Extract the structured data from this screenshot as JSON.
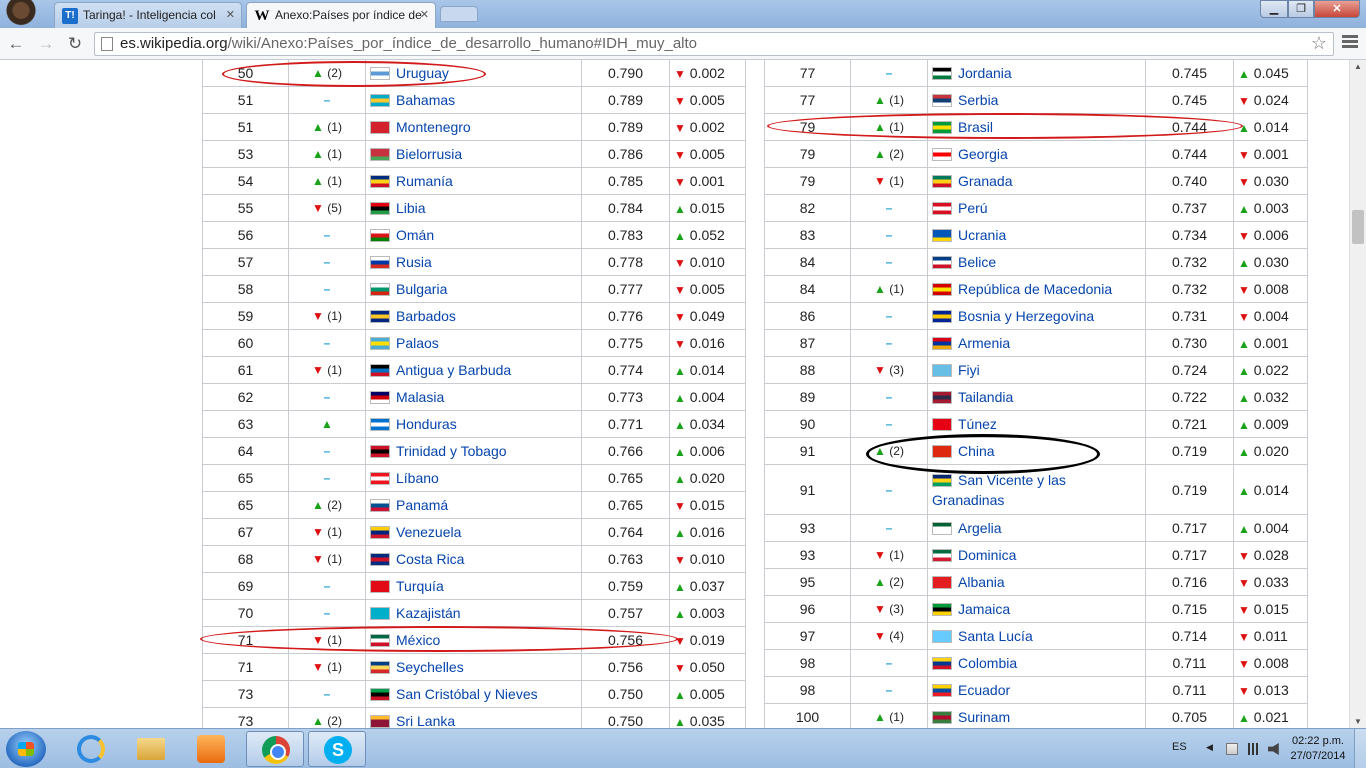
{
  "browser": {
    "tabs": [
      {
        "title": "Taringa! - Inteligencia col",
        "icon": "taringa-icon",
        "icon_text": "T!"
      },
      {
        "title": "Anexo:Países por índice de",
        "icon": "wikipedia-icon",
        "icon_text": "W"
      }
    ],
    "url_host": "es.wikipedia.org",
    "url_path": "/wiki/Anexo:Países_por_índice_de_desarrollo_humano#IDH_muy_alto"
  },
  "table_left": [
    {
      "rank": "50",
      "change": "up",
      "change_n": "(2)",
      "flag": [
        "#fff",
        "#5b9bd5",
        "#fff"
      ],
      "country": "Uruguay",
      "value": "0.790",
      "delta_dir": "down",
      "delta": "0.002"
    },
    {
      "rank": "51",
      "change": "none",
      "change_n": "",
      "flag": [
        "#00abc9",
        "#ffc72c",
        "#00abc9"
      ],
      "country": "Bahamas",
      "value": "0.789",
      "delta_dir": "down",
      "delta": "0.005"
    },
    {
      "rank": "51",
      "change": "up",
      "change_n": "(1)",
      "flag": [
        "#d3212d",
        "#d3212d",
        "#d3212d"
      ],
      "country": "Montenegro",
      "value": "0.789",
      "delta_dir": "down",
      "delta": "0.002"
    },
    {
      "rank": "53",
      "change": "up",
      "change_n": "(1)",
      "flag": [
        "#c8313e",
        "#c8313e",
        "#4aa657"
      ],
      "country": "Bielorrusia",
      "value": "0.786",
      "delta_dir": "down",
      "delta": "0.005"
    },
    {
      "rank": "54",
      "change": "up",
      "change_n": "(1)",
      "flag": [
        "#002b7f",
        "#fcd116",
        "#ce1126"
      ],
      "country": "Rumanía",
      "value": "0.785",
      "delta_dir": "down",
      "delta": "0.001"
    },
    {
      "rank": "55",
      "change": "down",
      "change_n": "(5)",
      "flag": [
        "#e70013",
        "#000",
        "#239e46"
      ],
      "country": "Libia",
      "value": "0.784",
      "delta_dir": "up",
      "delta": "0.015"
    },
    {
      "rank": "56",
      "change": "none",
      "change_n": "",
      "flag": [
        "#fff",
        "#db161b",
        "#008000"
      ],
      "country": "Omán",
      "value": "0.783",
      "delta_dir": "up",
      "delta": "0.052"
    },
    {
      "rank": "57",
      "change": "none",
      "change_n": "",
      "flag": [
        "#fff",
        "#0039a6",
        "#d52b1e"
      ],
      "country": "Rusia",
      "value": "0.778",
      "delta_dir": "down",
      "delta": "0.010"
    },
    {
      "rank": "58",
      "change": "none",
      "change_n": "",
      "flag": [
        "#fff",
        "#00966e",
        "#d62612"
      ],
      "country": "Bulgaria",
      "value": "0.777",
      "delta_dir": "down",
      "delta": "0.005"
    },
    {
      "rank": "59",
      "change": "down",
      "change_n": "(1)",
      "flag": [
        "#00267f",
        "#ffc726",
        "#00267f"
      ],
      "country": "Barbados",
      "value": "0.776",
      "delta_dir": "down",
      "delta": "0.049"
    },
    {
      "rank": "60",
      "change": "none",
      "change_n": "",
      "flag": [
        "#4aadd6",
        "#ffde00",
        "#4aadd6"
      ],
      "country": "Palaos",
      "value": "0.775",
      "delta_dir": "down",
      "delta": "0.016"
    },
    {
      "rank": "61",
      "change": "down",
      "change_n": "(1)",
      "flag": [
        "#000",
        "#0072c6",
        "#ce1126"
      ],
      "country": "Antigua y Barbuda",
      "value": "0.774",
      "delta_dir": "up",
      "delta": "0.014"
    },
    {
      "rank": "62",
      "change": "none",
      "change_n": "",
      "flag": [
        "#010066",
        "#cc0001",
        "#fff"
      ],
      "country": "Malasia",
      "value": "0.773",
      "delta_dir": "up",
      "delta": "0.004"
    },
    {
      "rank": "63",
      "change": "up",
      "change_n": "",
      "flag": [
        "#0073cf",
        "#fff",
        "#0073cf"
      ],
      "country": "Honduras",
      "value": "0.771",
      "delta_dir": "up",
      "delta": "0.034"
    },
    {
      "rank": "64",
      "change": "none",
      "change_n": "",
      "flag": [
        "#ce1126",
        "#000",
        "#ce1126"
      ],
      "country": "Trinidad y Tobago",
      "value": "0.766",
      "delta_dir": "up",
      "delta": "0.006"
    },
    {
      "rank": "65",
      "change": "none",
      "change_n": "",
      "flag": [
        "#ee161f",
        "#fff",
        "#ee161f"
      ],
      "country": "Líbano",
      "value": "0.765",
      "delta_dir": "up",
      "delta": "0.020"
    },
    {
      "rank": "65",
      "change": "up",
      "change_n": "(2)",
      "flag": [
        "#fff",
        "#005293",
        "#d21034"
      ],
      "country": "Panamá",
      "value": "0.765",
      "delta_dir": "down",
      "delta": "0.015"
    },
    {
      "rank": "67",
      "change": "down",
      "change_n": "(1)",
      "flag": [
        "#ffcc00",
        "#00247d",
        "#cf142b"
      ],
      "country": "Venezuela",
      "value": "0.764",
      "delta_dir": "up",
      "delta": "0.016"
    },
    {
      "rank": "68",
      "change": "down",
      "change_n": "(1)",
      "flag": [
        "#002b7f",
        "#ce1126",
        "#002b7f"
      ],
      "country": "Costa Rica",
      "value": "0.763",
      "delta_dir": "down",
      "delta": "0.010"
    },
    {
      "rank": "69",
      "change": "none",
      "change_n": "",
      "flag": [
        "#e30a17",
        "#e30a17",
        "#e30a17"
      ],
      "country": "Turquía",
      "value": "0.759",
      "delta_dir": "up",
      "delta": "0.037"
    },
    {
      "rank": "70",
      "change": "none",
      "change_n": "",
      "flag": [
        "#00afca",
        "#00afca",
        "#00afca"
      ],
      "country": "Kazajistán",
      "value": "0.757",
      "delta_dir": "up",
      "delta": "0.003"
    },
    {
      "rank": "71",
      "change": "down",
      "change_n": "(1)",
      "flag": [
        "#006847",
        "#fff",
        "#ce1126"
      ],
      "country": "México",
      "value": "0.756",
      "delta_dir": "down",
      "delta": "0.019"
    },
    {
      "rank": "71",
      "change": "down",
      "change_n": "(1)",
      "flag": [
        "#003f87",
        "#fcd856",
        "#d62828"
      ],
      "country": "Seychelles",
      "value": "0.756",
      "delta_dir": "down",
      "delta": "0.050"
    },
    {
      "rank": "73",
      "change": "none",
      "change_n": "",
      "flag": [
        "#009e49",
        "#000",
        "#ce1126"
      ],
      "country": "San Cristóbal y Nieves",
      "value": "0.750",
      "delta_dir": "up",
      "delta": "0.005"
    },
    {
      "rank": "73",
      "change": "up",
      "change_n": "(2)",
      "flag": [
        "#ffbe29",
        "#8d153a",
        "#8d153a"
      ],
      "country": "Sri Lanka",
      "value": "0.750",
      "delta_dir": "up",
      "delta": "0.035"
    }
  ],
  "table_right": [
    {
      "rank": "77",
      "change": "none",
      "change_n": "",
      "flag": [
        "#000",
        "#fff",
        "#007a3d"
      ],
      "country": "Jordania",
      "value": "0.745",
      "delta_dir": "up",
      "delta": "0.045"
    },
    {
      "rank": "77",
      "change": "up",
      "change_n": "(1)",
      "flag": [
        "#c6363c",
        "#0c4076",
        "#fff"
      ],
      "country": "Serbia",
      "value": "0.745",
      "delta_dir": "down",
      "delta": "0.024"
    },
    {
      "rank": "79",
      "change": "up",
      "change_n": "(1)",
      "flag": [
        "#009c3b",
        "#ffdf00",
        "#009c3b"
      ],
      "country": "Brasil",
      "value": "0.744",
      "delta_dir": "up",
      "delta": "0.014"
    },
    {
      "rank": "79",
      "change": "up",
      "change_n": "(2)",
      "flag": [
        "#fff",
        "#ff0000",
        "#fff"
      ],
      "country": "Georgia",
      "value": "0.744",
      "delta_dir": "down",
      "delta": "0.001"
    },
    {
      "rank": "79",
      "change": "down",
      "change_n": "(1)",
      "flag": [
        "#007a5e",
        "#fcd116",
        "#ce1126"
      ],
      "country": "Granada",
      "value": "0.740",
      "delta_dir": "down",
      "delta": "0.030"
    },
    {
      "rank": "82",
      "change": "none",
      "change_n": "",
      "flag": [
        "#d91023",
        "#fff",
        "#d91023"
      ],
      "country": "Perú",
      "value": "0.737",
      "delta_dir": "up",
      "delta": "0.003"
    },
    {
      "rank": "83",
      "change": "none",
      "change_n": "",
      "flag": [
        "#0057b7",
        "#0057b7",
        "#ffd700"
      ],
      "country": "Ucrania",
      "value": "0.734",
      "delta_dir": "down",
      "delta": "0.006"
    },
    {
      "rank": "84",
      "change": "none",
      "change_n": "",
      "flag": [
        "#003f87",
        "#fff",
        "#ce1126"
      ],
      "country": "Belice",
      "value": "0.732",
      "delta_dir": "up",
      "delta": "0.030"
    },
    {
      "rank": "84",
      "change": "up",
      "change_n": "(1)",
      "flag": [
        "#d20000",
        "#ffe600",
        "#d20000"
      ],
      "country": "República de Macedonia",
      "value": "0.732",
      "delta_dir": "down",
      "delta": "0.008"
    },
    {
      "rank": "86",
      "change": "none",
      "change_n": "",
      "flag": [
        "#002395",
        "#fecb00",
        "#002395"
      ],
      "country": "Bosnia y Herzegovina",
      "value": "0.731",
      "delta_dir": "down",
      "delta": "0.004"
    },
    {
      "rank": "87",
      "change": "none",
      "change_n": "",
      "flag": [
        "#d90012",
        "#0033a0",
        "#f2a800"
      ],
      "country": "Armenia",
      "value": "0.730",
      "delta_dir": "up",
      "delta": "0.001"
    },
    {
      "rank": "88",
      "change": "down",
      "change_n": "(3)",
      "flag": [
        "#68bfe5",
        "#68bfe5",
        "#68bfe5"
      ],
      "country": "Fiyi",
      "value": "0.724",
      "delta_dir": "up",
      "delta": "0.022"
    },
    {
      "rank": "89",
      "change": "none",
      "change_n": "",
      "flag": [
        "#a51931",
        "#2d2a4a",
        "#a51931"
      ],
      "country": "Tailandia",
      "value": "0.722",
      "delta_dir": "up",
      "delta": "0.032"
    },
    {
      "rank": "90",
      "change": "none",
      "change_n": "",
      "flag": [
        "#e70013",
        "#e70013",
        "#e70013"
      ],
      "country": "Túnez",
      "value": "0.721",
      "delta_dir": "up",
      "delta": "0.009"
    },
    {
      "rank": "91",
      "change": "up",
      "change_n": "(2)",
      "flag": [
        "#de2910",
        "#de2910",
        "#de2910"
      ],
      "country": "China",
      "value": "0.719",
      "delta_dir": "up",
      "delta": "0.020"
    },
    {
      "rank": "91",
      "change": "none",
      "change_n": "",
      "flag": [
        "#002675",
        "#fcd116",
        "#009e60"
      ],
      "country": "San Vicente y las Granadinas",
      "value": "0.719",
      "delta_dir": "up",
      "delta": "0.014",
      "tall": true
    },
    {
      "rank": "93",
      "change": "none",
      "change_n": "",
      "flag": [
        "#006233",
        "#fff",
        "#fff"
      ],
      "country": "Argelia",
      "value": "0.717",
      "delta_dir": "up",
      "delta": "0.004"
    },
    {
      "rank": "93",
      "change": "down",
      "change_n": "(1)",
      "flag": [
        "#006b3f",
        "#fff",
        "#d41c30"
      ],
      "country": "Dominica",
      "value": "0.717",
      "delta_dir": "down",
      "delta": "0.028"
    },
    {
      "rank": "95",
      "change": "up",
      "change_n": "(2)",
      "flag": [
        "#e41e20",
        "#e41e20",
        "#e41e20"
      ],
      "country": "Albania",
      "value": "0.716",
      "delta_dir": "down",
      "delta": "0.033"
    },
    {
      "rank": "96",
      "change": "down",
      "change_n": "(3)",
      "flag": [
        "#009b3a",
        "#000",
        "#fed100"
      ],
      "country": "Jamaica",
      "value": "0.715",
      "delta_dir": "down",
      "delta": "0.015"
    },
    {
      "rank": "97",
      "change": "down",
      "change_n": "(4)",
      "flag": [
        "#66ccff",
        "#66ccff",
        "#66ccff"
      ],
      "country": "Santa Lucía",
      "value": "0.714",
      "delta_dir": "down",
      "delta": "0.011"
    },
    {
      "rank": "98",
      "change": "none",
      "change_n": "",
      "flag": [
        "#fcd116",
        "#003893",
        "#ce1126"
      ],
      "country": "Colombia",
      "value": "0.711",
      "delta_dir": "down",
      "delta": "0.008"
    },
    {
      "rank": "98",
      "change": "none",
      "change_n": "",
      "flag": [
        "#ffd100",
        "#034ea2",
        "#ed1c24"
      ],
      "country": "Ecuador",
      "value": "0.711",
      "delta_dir": "down",
      "delta": "0.013"
    },
    {
      "rank": "100",
      "change": "up",
      "change_n": "(1)",
      "flag": [
        "#377e3f",
        "#b40a2d",
        "#377e3f"
      ],
      "country": "Surinam",
      "value": "0.705",
      "delta_dir": "up",
      "delta": "0.021"
    }
  ],
  "taskbar": {
    "lang": "ES",
    "time": "02:22 p.m.",
    "date": "27/07/2014",
    "skype_letter": "S"
  },
  "colors": {
    "up": "#1aa31a",
    "down": "#dd1111",
    "no_change": "#29a3d6",
    "link": "#0645ad",
    "highlight_red": "#d21a1a",
    "highlight_black": "#000000"
  }
}
